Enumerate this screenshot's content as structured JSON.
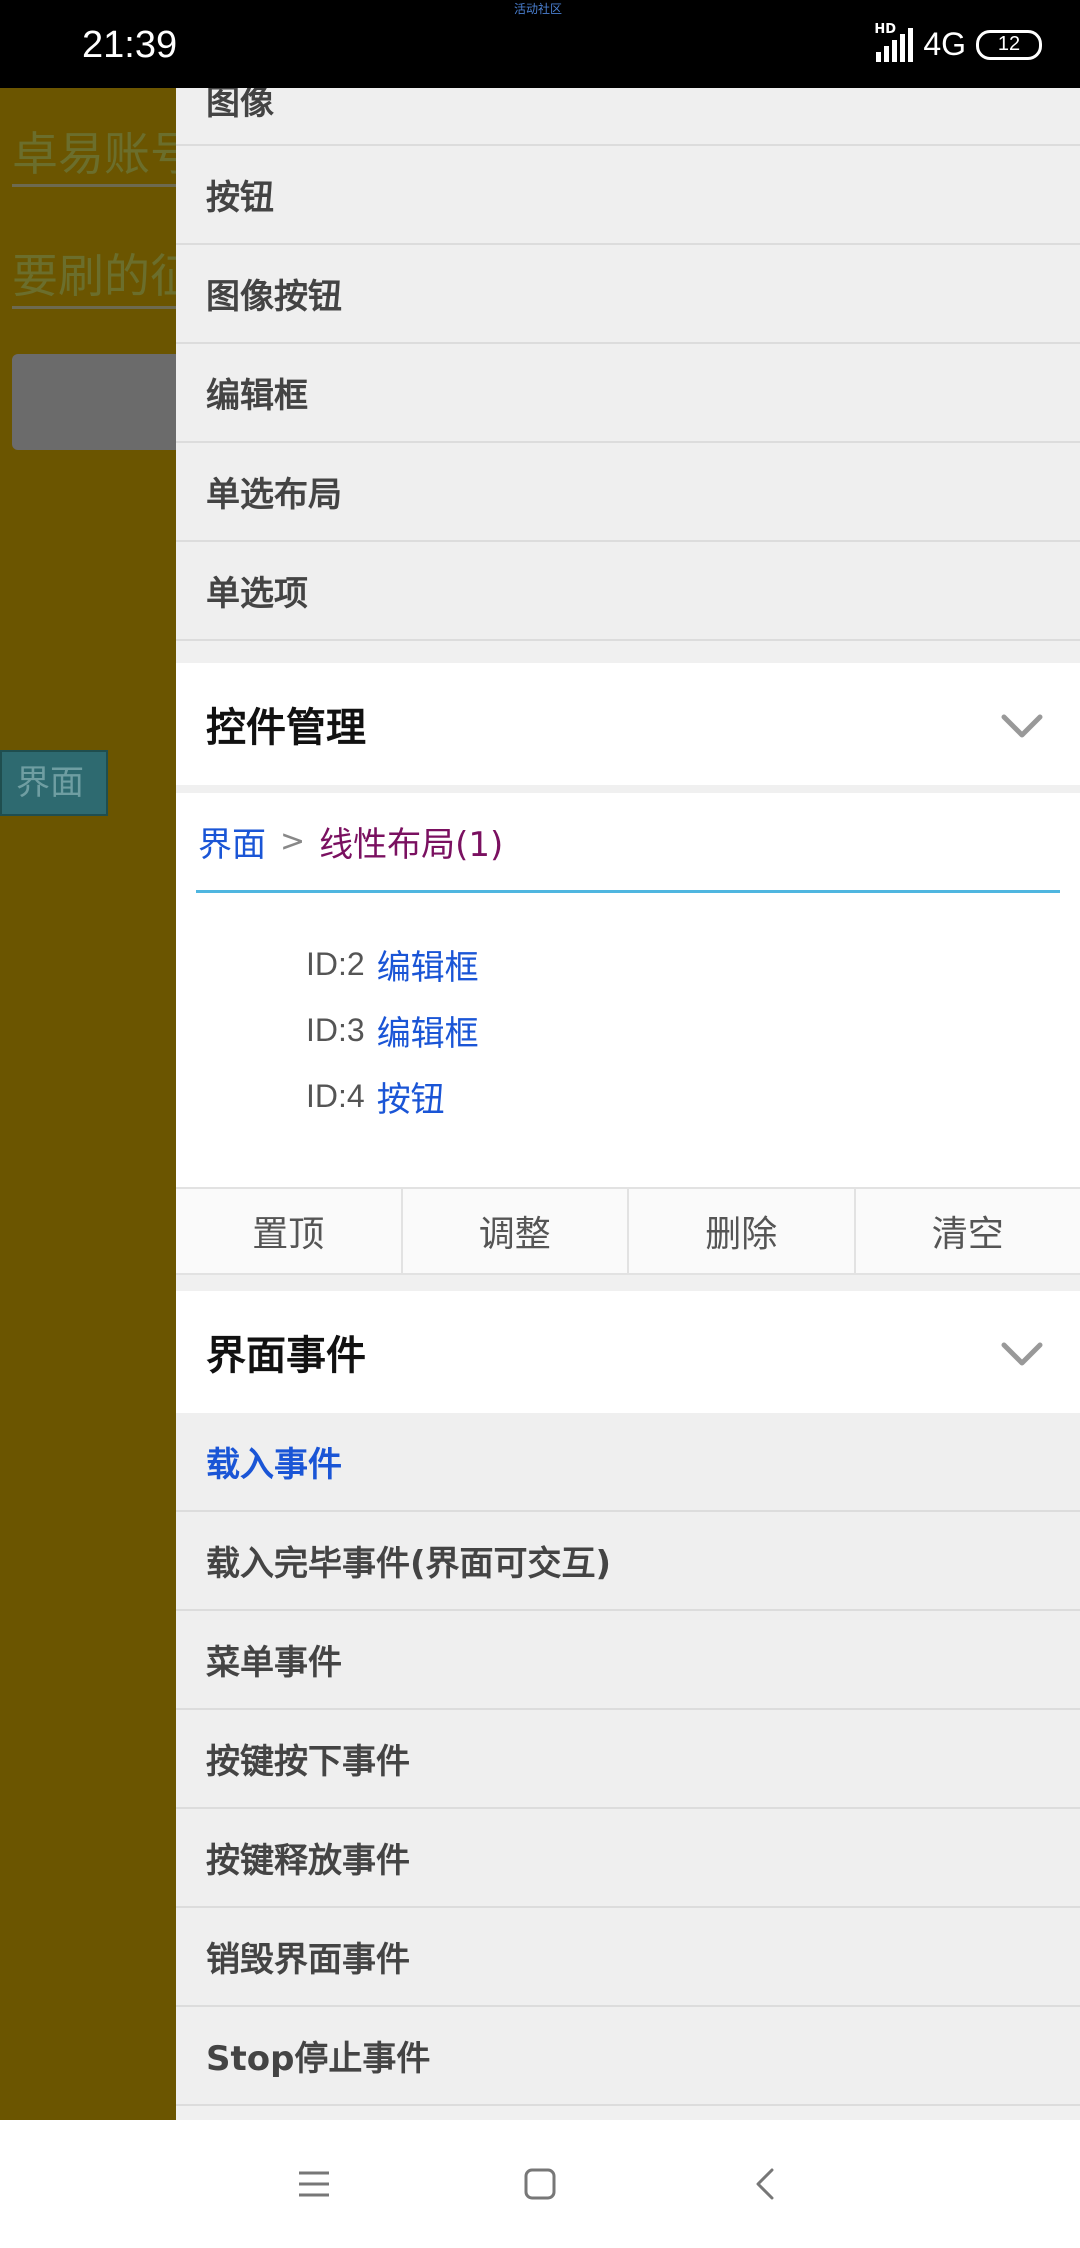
{
  "status_bar": {
    "time": "21:39",
    "carrier_tiny": "活动社区",
    "hd": "HD",
    "network": "4G",
    "battery": "12"
  },
  "background_app": {
    "field1": "卓易账号",
    "field2": "要刷的征",
    "tag": "界面"
  },
  "drawer": {
    "widget_items": [
      {
        "label": "图像"
      },
      {
        "label": "按钮"
      },
      {
        "label": "图像按钮"
      },
      {
        "label": "编辑框"
      },
      {
        "label": "单选布局"
      },
      {
        "label": "单选项"
      }
    ],
    "control_management": {
      "title": "控件管理",
      "breadcrumb": {
        "root": "界面",
        "separator": ">",
        "current": "线性布局(1)"
      },
      "tree": [
        {
          "id": "ID:2",
          "name": "编辑框"
        },
        {
          "id": "ID:3",
          "name": "编辑框"
        },
        {
          "id": "ID:4",
          "name": "按钮"
        }
      ],
      "actions": [
        "置顶",
        "调整",
        "删除",
        "清空"
      ]
    },
    "ui_events": {
      "title": "界面事件",
      "items": [
        {
          "label": "载入事件",
          "active": true
        },
        {
          "label": "载入完毕事件(界面可交互)"
        },
        {
          "label": "菜单事件"
        },
        {
          "label": "按键按下事件"
        },
        {
          "label": "按键释放事件"
        },
        {
          "label": "销毁界面事件"
        },
        {
          "label": "Stop停止事件"
        }
      ]
    }
  },
  "colors": {
    "accent": "#1a55d6",
    "breadcrumb_current": "#7a1060",
    "underline": "#4fb6e0",
    "background_app": "#6b5500"
  },
  "icons": [
    "menu-icon",
    "home-icon",
    "back-icon",
    "chevron-down-icon"
  ]
}
